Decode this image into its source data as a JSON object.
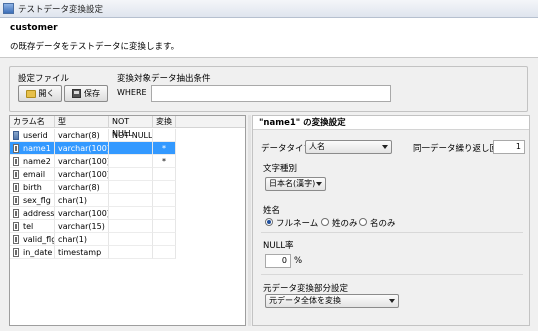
{
  "window": {
    "title": "テストデータ変換設定"
  },
  "header": {
    "title": "customer",
    "description": "の既存データをテストデータに変換します。"
  },
  "top": {
    "file_label": "設定ファイル",
    "open_label": "開く",
    "save_label": "保存",
    "condition_label": "変換対象データ抽出条件",
    "where_label": "WHERE",
    "where_value": ""
  },
  "grid": {
    "headers": [
      "カラム名",
      "型",
      "NOT NULL",
      "変換"
    ],
    "rows": [
      {
        "name": "userid",
        "type": "varchar(8)",
        "notnull": "NOT NULL",
        "convert": "",
        "key": true
      },
      {
        "name": "name1",
        "type": "varchar(100)",
        "notnull": "",
        "convert": "*",
        "selected": true
      },
      {
        "name": "name2",
        "type": "varchar(100)",
        "notnull": "",
        "convert": "*"
      },
      {
        "name": "email",
        "type": "varchar(100)",
        "notnull": "",
        "convert": ""
      },
      {
        "name": "birth",
        "type": "varchar(8)",
        "notnull": "",
        "convert": ""
      },
      {
        "name": "sex_flg",
        "type": "char(1)",
        "notnull": "",
        "convert": ""
      },
      {
        "name": "address",
        "type": "varchar(100)",
        "notnull": "",
        "convert": ""
      },
      {
        "name": "tel",
        "type": "varchar(15)",
        "notnull": "",
        "convert": ""
      },
      {
        "name": "valid_flg",
        "type": "char(1)",
        "notnull": "",
        "convert": ""
      },
      {
        "name": "in_date",
        "type": "timestamp",
        "notnull": "",
        "convert": ""
      }
    ]
  },
  "detail": {
    "title": "\"name1\" の変換設定",
    "data_type_label": "データタイプ",
    "data_type_value": "人名",
    "repeat_label": "同一データ繰り返し回数",
    "repeat_value": "1",
    "char_type_label": "文字種別",
    "char_type_value": "日本名(漢字)",
    "name_label": "姓名",
    "name_options": [
      "フルネーム",
      "姓のみ",
      "名のみ"
    ],
    "name_selected": "フルネーム",
    "null_rate_label": "NULL率",
    "null_rate_value": "0",
    "null_rate_unit": "%",
    "partial_label": "元データ変換部分設定",
    "partial_value": "元データ全体を変換"
  },
  "colors": {
    "selection": "#3399ff",
    "radio_dot": "#1f4f9e"
  },
  "icons": [
    "app-icon",
    "folder-open-icon",
    "save-icon",
    "primary-key-icon",
    "column-icon",
    "chevron-down-icon",
    "radio-icon"
  ]
}
